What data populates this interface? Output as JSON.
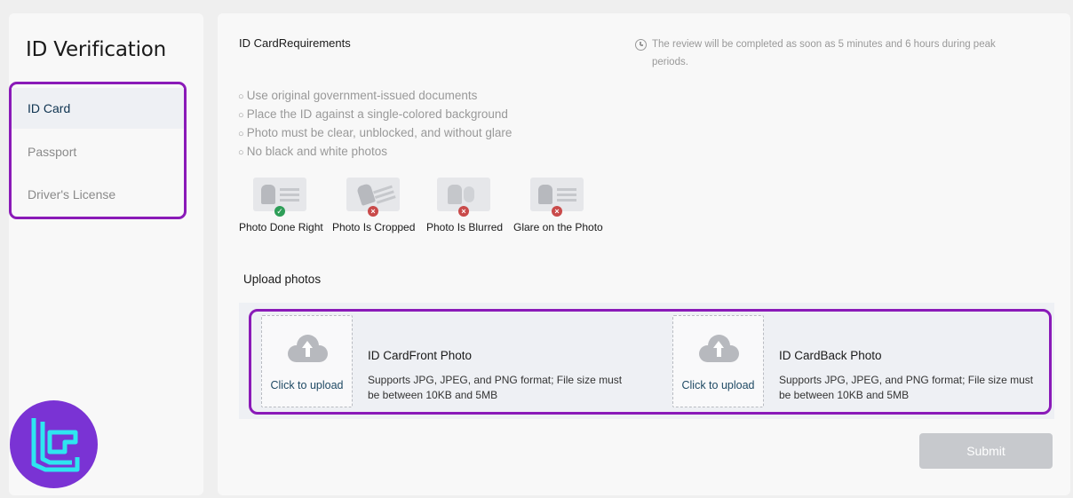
{
  "sidebar": {
    "title": "ID Verification",
    "items": [
      {
        "label": "ID Card",
        "active": true
      },
      {
        "label": "Passport",
        "active": false
      },
      {
        "label": "Driver's License",
        "active": false
      }
    ]
  },
  "requirements": {
    "title": "ID CardRequirements",
    "review_note": "The review will be completed as soon as 5 minutes and 6 hours during peak periods.",
    "rules": [
      "Use original government-issued documents",
      "Place the ID against a single-colored background",
      "Photo must be clear, unblocked, and without glare",
      "No black and white photos"
    ],
    "samples": [
      {
        "label": "Photo Done Right",
        "status": "ok"
      },
      {
        "label": "Photo Is Cropped",
        "status": "bad"
      },
      {
        "label": "Photo Is Blurred",
        "status": "bad"
      },
      {
        "label": "Glare on the Photo",
        "status": "bad"
      }
    ]
  },
  "upload": {
    "title": "Upload photos",
    "front": {
      "click_label": "Click to upload",
      "title": "ID CardFront Photo",
      "description": "Supports JPG, JPEG, and PNG format; File size must be between 10KB and 5MB"
    },
    "back": {
      "click_label": "Click to upload",
      "title": "ID CardBack Photo",
      "description": "Supports JPG, JPEG, and PNG format; File size must be between 10KB and 5MB"
    }
  },
  "submit_label": "Submit",
  "colors": {
    "highlight": "#8a1ab8",
    "logo": "#7a33d4",
    "logo_mark": "#2ee6f0",
    "ok": "#2e9e58",
    "bad": "#c94a4a"
  },
  "icons": {
    "clock": "clock-icon",
    "upload": "cloud-upload-icon",
    "check": "check-icon",
    "cross": "cross-icon"
  }
}
